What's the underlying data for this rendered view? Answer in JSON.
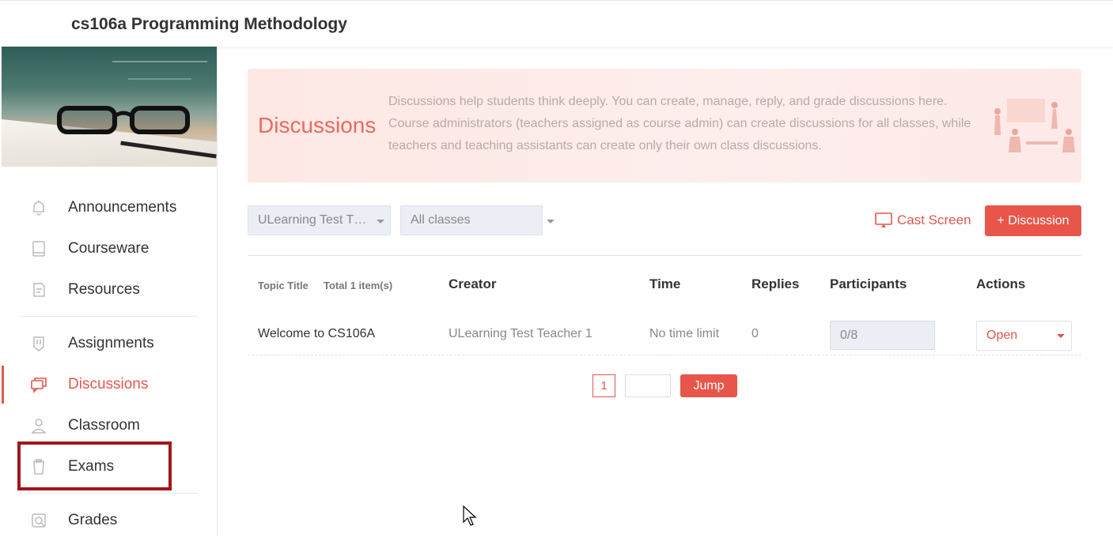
{
  "app": {
    "title": "cs106a Programming Methodology"
  },
  "sidebar": {
    "items": [
      {
        "label": "Announcements",
        "icon": "bell-icon"
      },
      {
        "label": "Courseware",
        "icon": "book-icon"
      },
      {
        "label": "Resources",
        "icon": "resources-icon"
      },
      {
        "label": "Assignments",
        "icon": "assignment-icon"
      },
      {
        "label": "Discussions",
        "icon": "chat-icon",
        "active": true
      },
      {
        "label": "Classroom",
        "icon": "person-icon"
      },
      {
        "label": "Exams",
        "icon": "clipboard-icon",
        "highlighted": true
      },
      {
        "label": "Grades",
        "icon": "grades-icon"
      }
    ]
  },
  "banner": {
    "title": "Discussions",
    "description": "Discussions help students think deeply. You can create, manage, reply, and grade discussions here. Course administrators (teachers assigned as course admin) can create discussions for all classes, while teachers and teaching assistants can create only their own class discussions."
  },
  "toolbar": {
    "teacher_select": "ULearning Test T…",
    "class_select": "All classes",
    "cast_label": "Cast Screen",
    "add_label": "+ Discussion"
  },
  "table": {
    "headers": {
      "topic": "Topic Title",
      "total": "Total 1 item(s)",
      "creator": "Creator",
      "time": "Time",
      "replies": "Replies",
      "participants": "Participants",
      "actions": "Actions"
    },
    "rows": [
      {
        "topic": "Welcome to CS106A",
        "creator": "ULearning Test Teacher 1",
        "time": "No time limit",
        "replies": "0",
        "participants": "0/8",
        "action": "Open"
      }
    ]
  },
  "pagination": {
    "current_page": "1",
    "jump_label": "Jump"
  },
  "colors": {
    "accent": "#e8554a",
    "banner_bg": "#fde8e4",
    "highlight_border": "#a0161b"
  }
}
